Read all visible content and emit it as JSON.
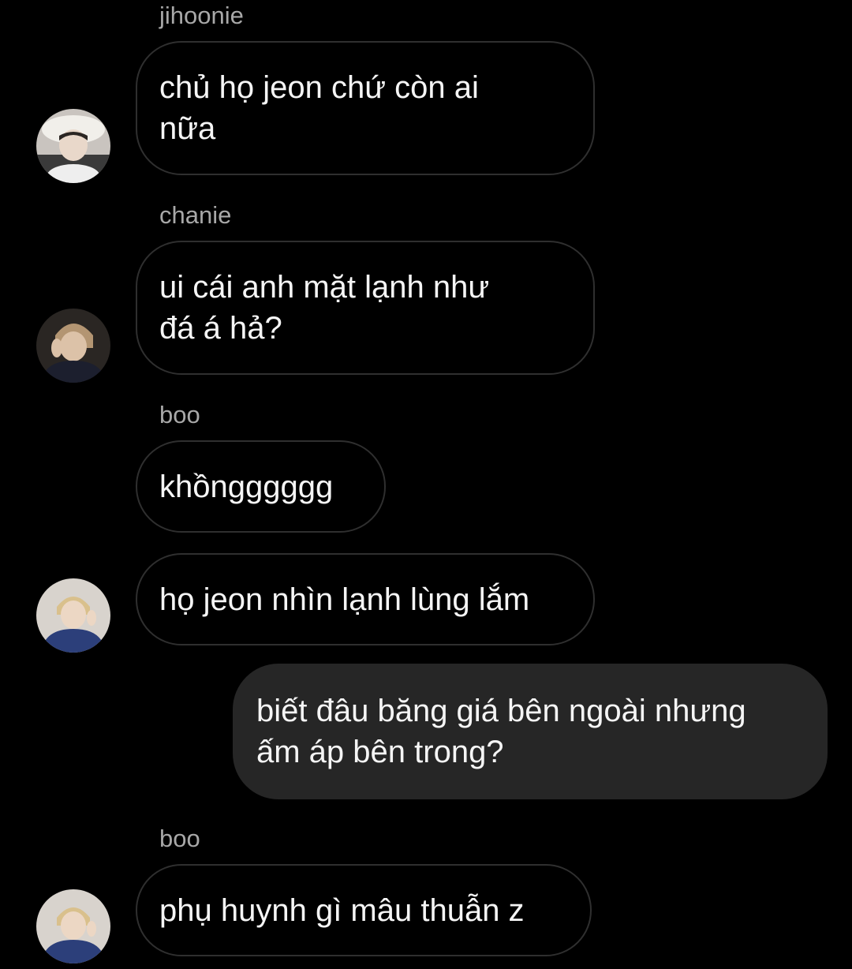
{
  "chat": {
    "messages": [
      {
        "sender": "jihoonie",
        "text": "chủ họ jeon chứ còn ai\nnữa"
      },
      {
        "sender": "chanie",
        "text": "ui cái anh mặt lạnh như\nđá á hả?"
      },
      {
        "sender": "boo",
        "text": "khồngggggg"
      },
      {
        "text": "họ jeon nhìn lạnh lùng lắm"
      },
      {
        "text": "biết đâu băng giá bên ngoài nhưng\nấm áp bên trong?"
      },
      {
        "sender": "boo",
        "text": "phụ huynh gì mâu thuẫn z"
      }
    ]
  },
  "colors": {
    "background": "#000000",
    "incoming_border": "#2f2f2f",
    "outgoing_bubble": "#262626",
    "sender_name": "#a8a8a8",
    "message_text": "#f5f5f5"
  },
  "icons": {
    "avatars": [
      "avatar-jihoonie",
      "avatar-chanie",
      "avatar-boo",
      "avatar-boo"
    ]
  }
}
